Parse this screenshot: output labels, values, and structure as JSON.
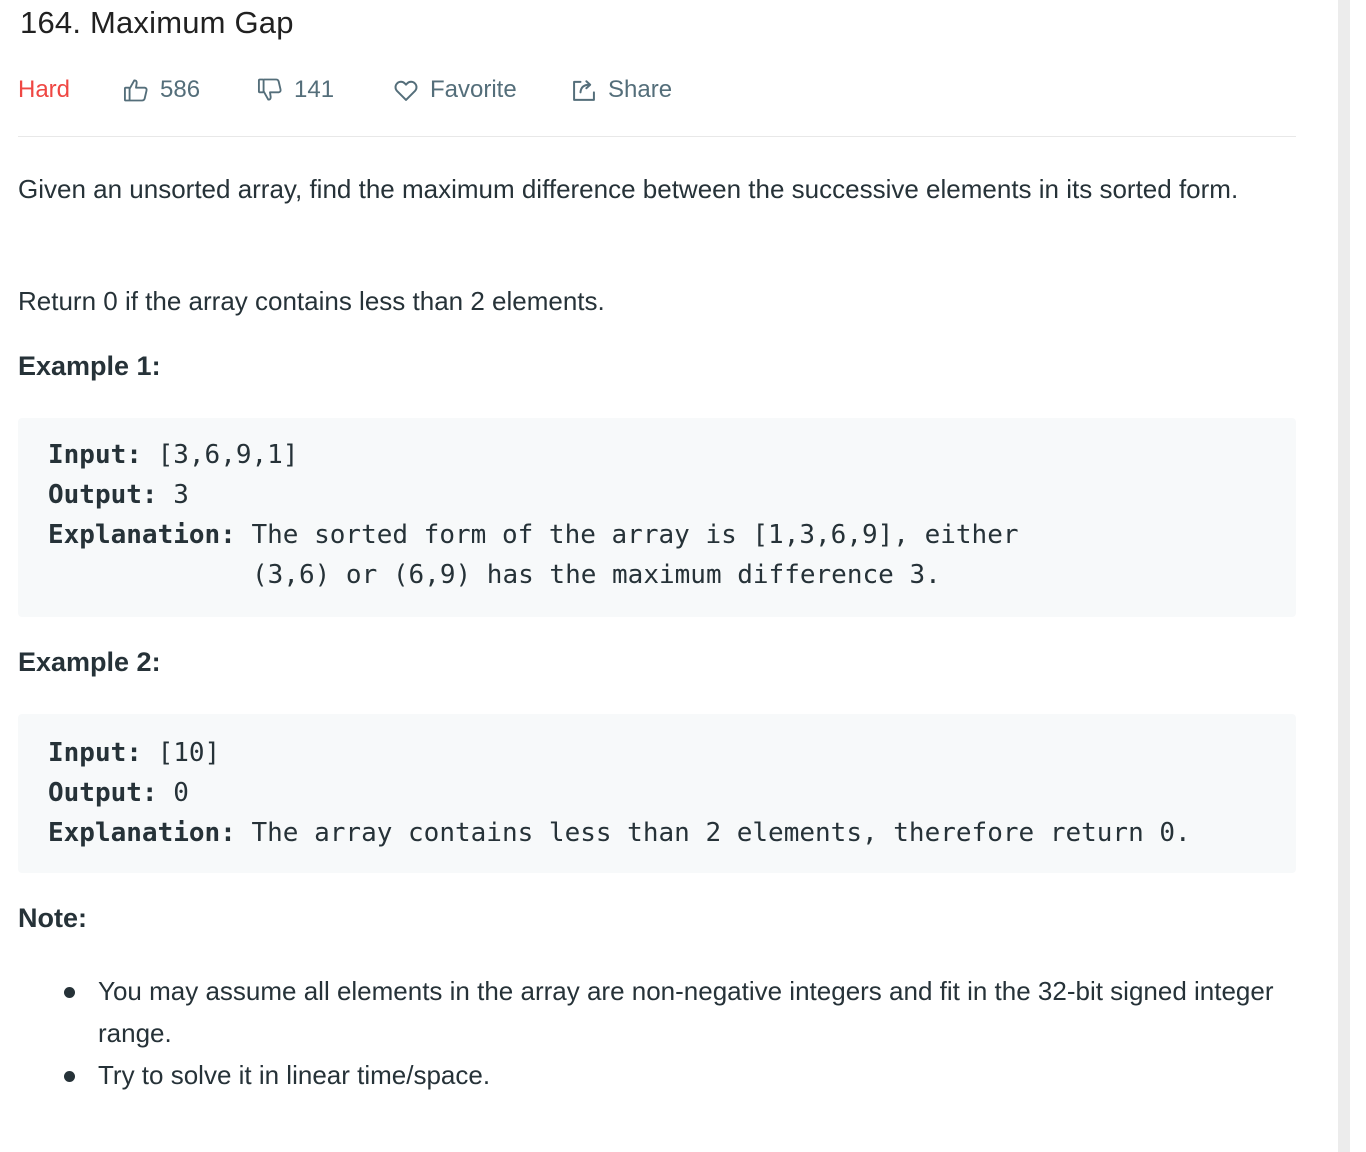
{
  "problem": {
    "title": "164. Maximum Gap",
    "difficulty": "Hard",
    "likes": "586",
    "dislikes": "141",
    "favorite_label": "Favorite",
    "share_label": "Share"
  },
  "description": {
    "paragraph1": "Given an unsorted array, find the maximum difference between the successive elements in its sorted form.",
    "paragraph2": "Return 0 if the array contains less than 2 elements."
  },
  "example1": {
    "heading": "Example 1:",
    "input_label": "Input:",
    "input_value": " [3,6,9,1]",
    "output_label": "Output:",
    "output_value": " 3",
    "explanation_label": "Explanation:",
    "explanation_line1": " The sorted form of the array is [1,3,6,9], either",
    "explanation_line2": "(3,6) or (6,9) has the maximum difference 3."
  },
  "example2": {
    "heading": "Example 2:",
    "input_label": "Input:",
    "input_value": " [10]",
    "output_label": "Output:",
    "output_value": " 0",
    "explanation_label": "Explanation:",
    "explanation_line1": " The array contains less than 2 elements, therefore return 0."
  },
  "note": {
    "heading": "Note:",
    "items": [
      "You may assume all elements in the array are non-negative integers and fit in the 32-bit signed integer range.",
      "Try to solve it in linear time/space."
    ]
  },
  "icons": {
    "likes": "thumbs-up-icon",
    "dislikes": "thumbs-down-icon",
    "favorite": "heart-icon",
    "share": "share-icon"
  },
  "colors": {
    "difficulty_hard": "#ef4743",
    "meta_text": "#546e7a",
    "code_background": "#f7f9fa",
    "body_text": "#263238"
  }
}
